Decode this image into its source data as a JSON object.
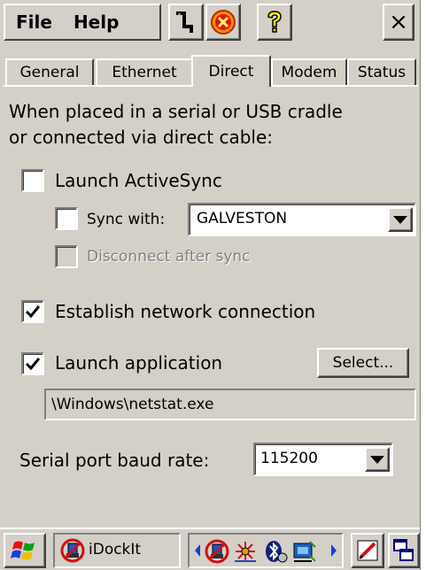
{
  "menu": {
    "file": "File",
    "help": "Help"
  },
  "toolbar": {
    "icons": [
      "network-wire-icon",
      "stop-icon",
      "help-question-icon"
    ],
    "close": "×"
  },
  "tabs": [
    {
      "label": "General",
      "active": false
    },
    {
      "label": "Ethernet",
      "active": false
    },
    {
      "label": "Direct",
      "active": true
    },
    {
      "label": "Modem",
      "active": false
    },
    {
      "label": "Status",
      "active": false
    }
  ],
  "direct": {
    "intro_line1": "When placed in a serial or USB cradle",
    "intro_line2": "or connected via direct cable:",
    "launch_activesync": {
      "label": "Launch ActiveSync",
      "checked": false
    },
    "sync_with": {
      "label": "Sync with:",
      "checked": false,
      "value": "GALVESTON"
    },
    "disconnect_after_sync": {
      "label": "Disconnect after sync",
      "checked": false,
      "enabled": false
    },
    "establish_network": {
      "label": "Establish network connection",
      "checked": true
    },
    "launch_application": {
      "label": "Launch application",
      "checked": true
    },
    "select_button": "Select...",
    "app_path": "\\Windows\\netstat.exe",
    "baud_label": "Serial port baud rate:",
    "baud_value": "115200"
  },
  "taskbar": {
    "app_label": "iDockIt"
  },
  "colors": {
    "face": "#d4d0c8",
    "highlight": "#ffffff",
    "shadow": "#808080",
    "dark_shadow": "#404040"
  }
}
